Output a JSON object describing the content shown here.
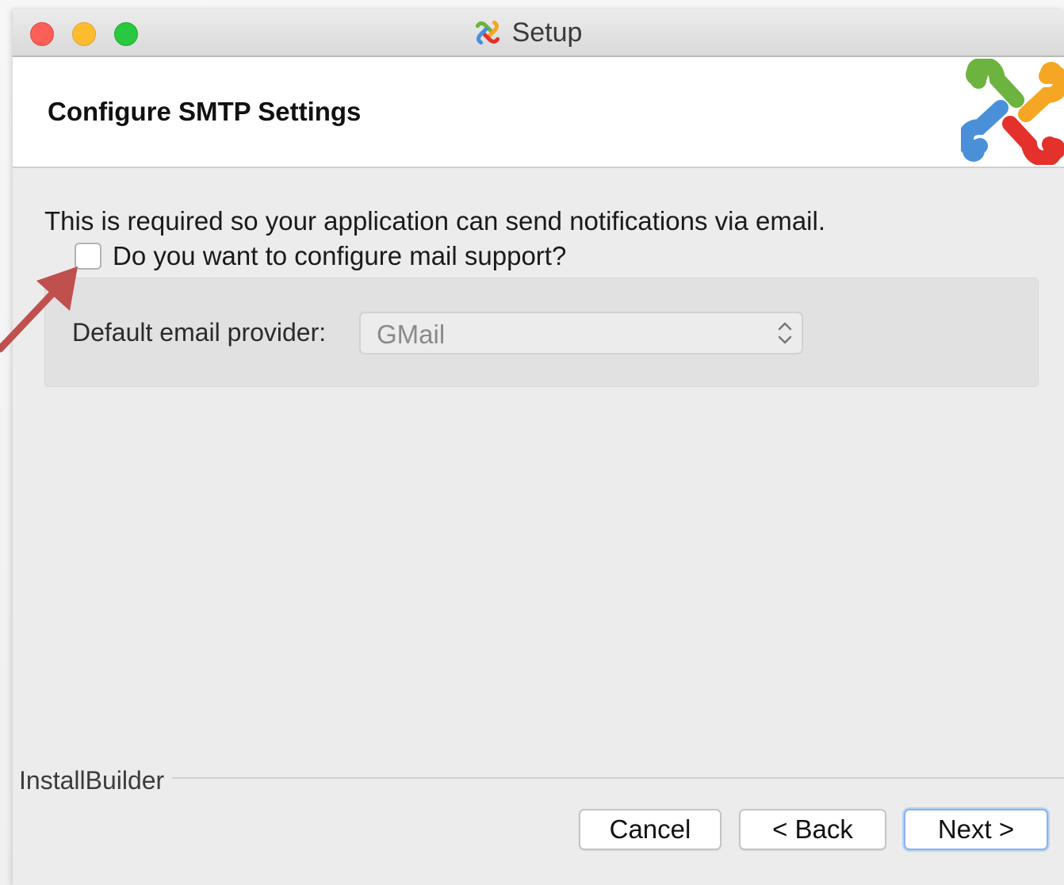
{
  "window": {
    "title": "Setup"
  },
  "header": {
    "title": "Configure SMTP Settings"
  },
  "body": {
    "description": "This is required so your application can send notifications via email.",
    "mail_checkbox": {
      "label": "Do you want to configure mail support?",
      "checked": false
    },
    "provider": {
      "label": "Default email provider:",
      "value": "GMail"
    }
  },
  "footer": {
    "brand": "InstallBuilder",
    "cancel_label": "Cancel",
    "back_label": "< Back",
    "next_label": "Next >"
  },
  "colors": {
    "annotation_arrow": "#c0504d",
    "logo_green": "#6cb33f",
    "logo_orange": "#f5a623",
    "logo_red": "#e4312b",
    "logo_blue": "#4a90d9"
  }
}
